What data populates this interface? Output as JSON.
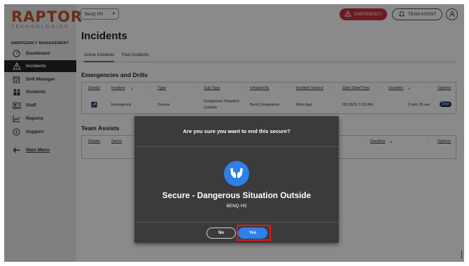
{
  "logo": {
    "main": "RAPTOR",
    "sub": "TECHNOLOGIES",
    "color": "#c5542d"
  },
  "sidebar": {
    "section": "EMERGENCY MANAGEMENT",
    "items": [
      {
        "label": "Dashboard",
        "icon": "dashboard-gauge-icon"
      },
      {
        "label": "Incidents",
        "icon": "warning-triangle-icon",
        "active": true
      },
      {
        "label": "Drill Manager",
        "icon": "calendar-check-icon"
      },
      {
        "label": "Students",
        "icon": "students-icon"
      },
      {
        "label": "Staff",
        "icon": "staff-badge-icon"
      },
      {
        "label": "Reports",
        "icon": "chart-line-icon"
      },
      {
        "label": "Support",
        "icon": "help-circle-icon"
      },
      {
        "label": "Main Menu",
        "icon": "arrow-left-icon"
      }
    ]
  },
  "header": {
    "school_select": "BenQ HS",
    "emergency_label": "EMERGENCY",
    "team_assist_label": "TEAM ASSIST",
    "emergency_color": "#c8323c"
  },
  "page": {
    "title": "Incidents",
    "tabs": [
      "Active Incidents",
      "Past Incidents"
    ]
  },
  "emergencies": {
    "title": "Emergencies and Drills",
    "columns": [
      "Details",
      "Incident",
      "Type",
      "Sub Type",
      "Initiated By",
      "Incident Source",
      "Start Date/Time",
      "Duration",
      "Options"
    ],
    "row": {
      "incident": "Emergency",
      "type": "Secure",
      "subtype_line1": "Dangerous Situation",
      "subtype_line2": "Outside",
      "initiated_by": "BenQ Integration",
      "source": "Web App",
      "start": "05/18/26 2:29 AM",
      "duration": "3 min 35 sec",
      "option_label": "End"
    }
  },
  "team_assists": {
    "title": "Team Assists",
    "columns": [
      "Details",
      "Name",
      "Duration",
      "Options"
    ]
  },
  "modal": {
    "question": "Are you sure you want to end this secure?",
    "icon": "raised-hands-icon",
    "title": "Secure - Dangerous Situation Outside",
    "subtitle": "BENQ HS",
    "no_label": "No",
    "yes_label": "Yes",
    "accent": "#2f7fe8",
    "highlight": "#e5161c"
  }
}
